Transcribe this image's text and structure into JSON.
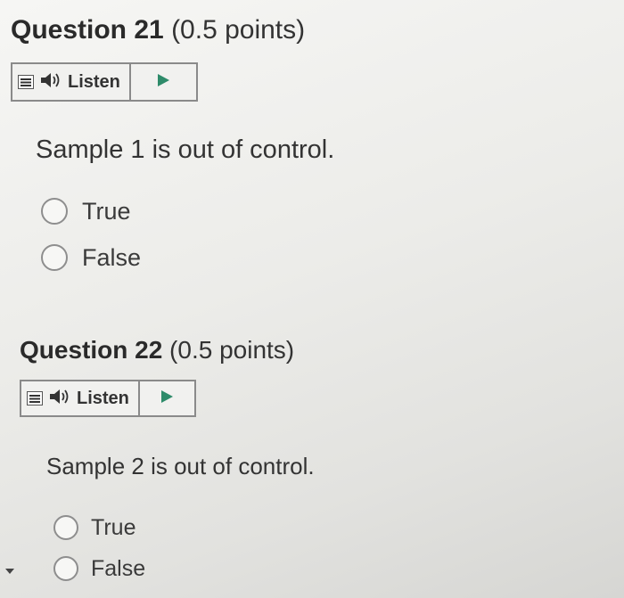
{
  "questions": [
    {
      "title": "Question 21",
      "points": "(0.5 points)",
      "listen_label": "Listen",
      "prompt": "Sample 1 is out of control.",
      "options": [
        "True",
        "False"
      ]
    },
    {
      "title": "Question 22",
      "points": "(0.5 points)",
      "listen_label": "Listen",
      "prompt": "Sample 2 is out of control.",
      "options": [
        "True",
        "False"
      ]
    }
  ],
  "icons": {
    "menu": "menu-icon",
    "speaker": "speaker-icon",
    "play": "play-icon",
    "scroll": "caret-down-icon"
  },
  "colors": {
    "play_arrow": "#2e8b6a",
    "border": "#8a8a8a"
  }
}
